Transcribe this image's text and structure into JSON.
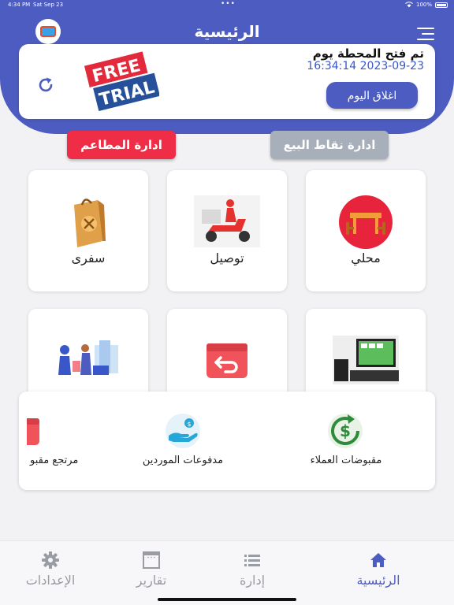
{
  "status_bar": {
    "time": "4:34 PM",
    "date": "Sat Sep 23",
    "dots": "•••",
    "battery": "100%"
  },
  "header": {
    "title": "الرئيسية"
  },
  "session": {
    "title": "تم فتح المحطة يوم",
    "datetime": "16:34:14 2023-09-23",
    "close_day_label": "اغلاق اليوم",
    "free_trial_line1": "FREE",
    "free_trial_line2": "TRIAL"
  },
  "actions": {
    "pos_management": "ادارة نقاط البيع",
    "restaurant_management": "ادارة المطاعم"
  },
  "tiles": [
    {
      "label": "محلي",
      "icon": "dine-in-table-icon"
    },
    {
      "label": "توصيل",
      "icon": "delivery-scooter-icon"
    },
    {
      "label": "سفرى",
      "icon": "takeaway-bag-icon"
    },
    {
      "label": "",
      "icon": "pos-terminal-icon"
    },
    {
      "label": "",
      "icon": "return-box-icon"
    },
    {
      "label": "",
      "icon": "shopping-people-icon"
    }
  ],
  "shortcuts": [
    {
      "label": "مقبوضات العملاء",
      "icon": "dollar-cycle-icon"
    },
    {
      "label": "مدفوعات الموردين",
      "icon": "hand-coin-icon"
    },
    {
      "label": "مرتجع مقبو",
      "icon": "return-icon"
    }
  ],
  "tabs": [
    {
      "label": "الرئيسية",
      "icon": "home-icon",
      "active": true
    },
    {
      "label": "إدارة",
      "icon": "list-icon",
      "active": false
    },
    {
      "label": "تقارير",
      "icon": "report-icon",
      "active": false
    },
    {
      "label": "الإعدادات",
      "icon": "gear-icon",
      "active": false
    }
  ],
  "colors": {
    "primary": "#4d5cc0",
    "danger": "#f02d46",
    "muted_button": "#a7afba",
    "datetime_text": "#3a57c9"
  }
}
